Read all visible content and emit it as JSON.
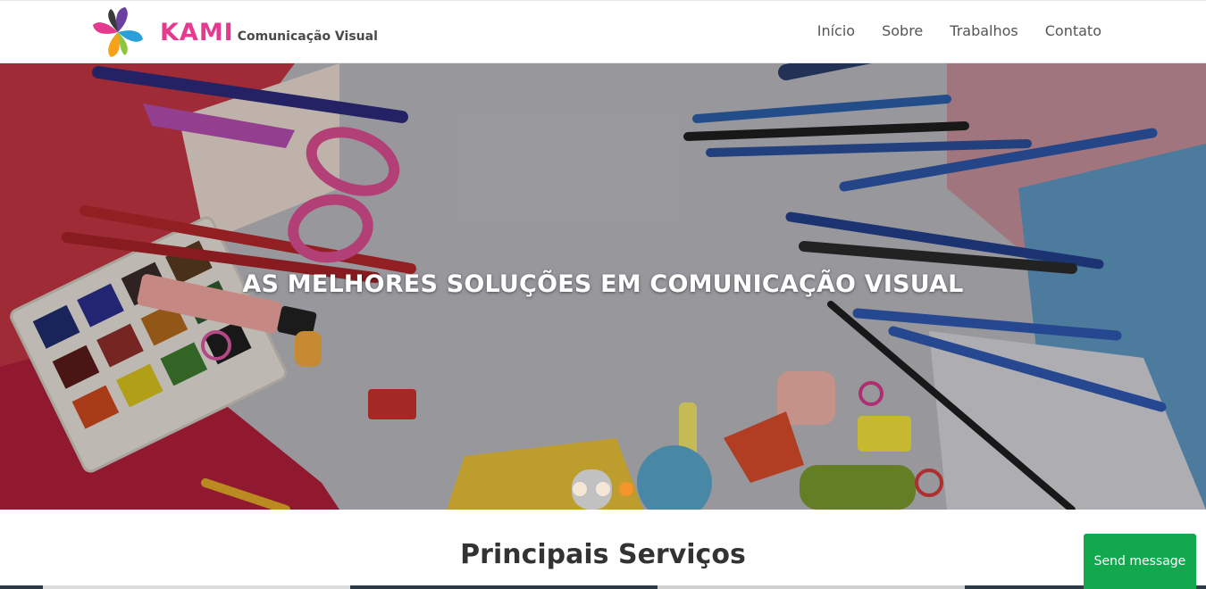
{
  "header": {
    "brand": "KAMI",
    "tagline": "Comunicação Visual",
    "logo_icon": "pinwheel-logo-icon",
    "nav": [
      {
        "label": "Início"
      },
      {
        "label": "Sobre"
      },
      {
        "label": "Trabalhos"
      },
      {
        "label": "Contato"
      }
    ]
  },
  "hero": {
    "title": "AS MELHORES SOLUÇÕES EM COMUNICAÇÃO VISUAL",
    "slides": 3,
    "active_slide": 3,
    "image": "art-supplies-background"
  },
  "services": {
    "title": "Principais Serviços"
  },
  "chat": {
    "label": "Send message"
  },
  "colors": {
    "brand_pink": "#e53a8f",
    "dot_active": "#f5942b",
    "chat_green": "#11a84e"
  }
}
